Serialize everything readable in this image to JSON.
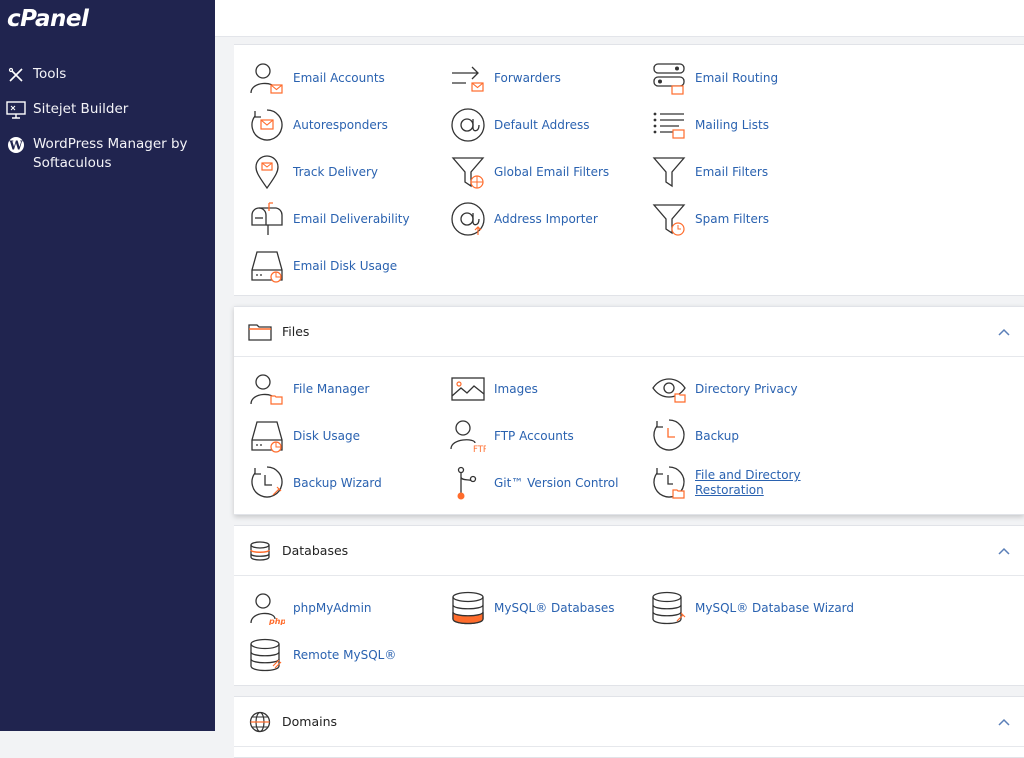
{
  "brand": "cPanel",
  "sidebar": {
    "items": [
      {
        "label": "Tools"
      },
      {
        "label": "Sitejet Builder"
      },
      {
        "label": "WordPress Manager by Softaculous"
      }
    ]
  },
  "email": {
    "items": [
      {
        "label": "Email Accounts"
      },
      {
        "label": "Forwarders"
      },
      {
        "label": "Email Routing"
      },
      {
        "label": "Autoresponders"
      },
      {
        "label": "Default Address"
      },
      {
        "label": "Mailing Lists"
      },
      {
        "label": "Track Delivery"
      },
      {
        "label": "Global Email Filters"
      },
      {
        "label": "Email Filters"
      },
      {
        "label": "Email Deliverability"
      },
      {
        "label": "Address Importer"
      },
      {
        "label": "Spam Filters"
      },
      {
        "label": "Email Disk Usage"
      }
    ]
  },
  "files": {
    "title": "Files",
    "items": [
      {
        "label": "File Manager"
      },
      {
        "label": "Images"
      },
      {
        "label": "Directory Privacy"
      },
      {
        "label": "Disk Usage"
      },
      {
        "label": "FTP Accounts"
      },
      {
        "label": "Backup"
      },
      {
        "label": "Backup Wizard"
      },
      {
        "label": "Git™ Version Control"
      },
      {
        "label": "File and Directory Restoration"
      }
    ]
  },
  "databases": {
    "title": "Databases",
    "items": [
      {
        "label": "phpMyAdmin"
      },
      {
        "label": "MySQL® Databases"
      },
      {
        "label": "MySQL® Database Wizard"
      },
      {
        "label": "Remote MySQL®"
      }
    ]
  },
  "domains": {
    "title": "Domains"
  },
  "colors": {
    "sidebar_bg": "#20244f",
    "link": "#2a62b0",
    "accent": "#ff6c2c"
  }
}
